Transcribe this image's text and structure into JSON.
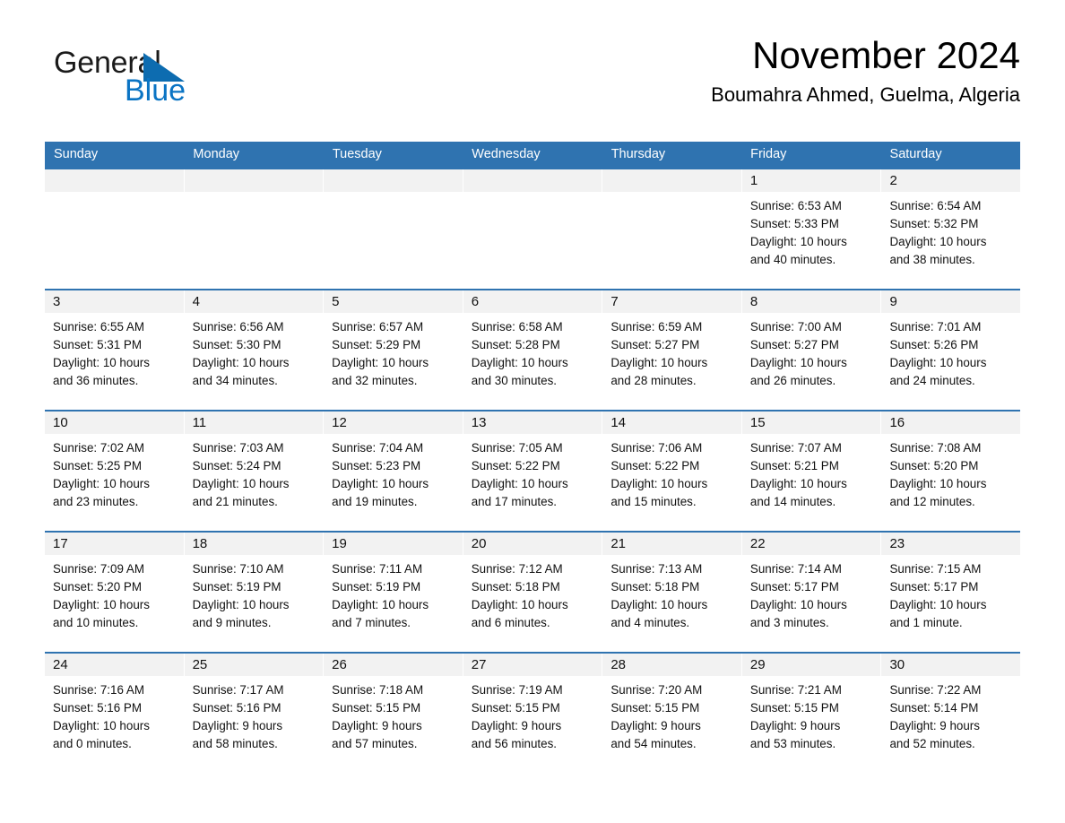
{
  "brand": {
    "word_one": "General",
    "word_two": "Blue",
    "triangle_icon": "triangle-icon",
    "blue_hex": "#0a74c4"
  },
  "header": {
    "title": "November 2024",
    "subtitle": "Boumahra Ahmed, Guelma, Algeria"
  },
  "theme": {
    "header_blue": "#2f73b0",
    "daynum_band": "#f2f2f2",
    "text": "#111111"
  },
  "weekday_headers": [
    "Sunday",
    "Monday",
    "Tuesday",
    "Wednesday",
    "Thursday",
    "Friday",
    "Saturday"
  ],
  "weeks": [
    {
      "days": [
        {
          "date": "",
          "sunrise": "",
          "sunset": "",
          "daylight_line1": "",
          "daylight_line2": "",
          "empty": true
        },
        {
          "date": "",
          "sunrise": "",
          "sunset": "",
          "daylight_line1": "",
          "daylight_line2": "",
          "empty": true
        },
        {
          "date": "",
          "sunrise": "",
          "sunset": "",
          "daylight_line1": "",
          "daylight_line2": "",
          "empty": true
        },
        {
          "date": "",
          "sunrise": "",
          "sunset": "",
          "daylight_line1": "",
          "daylight_line2": "",
          "empty": true
        },
        {
          "date": "",
          "sunrise": "",
          "sunset": "",
          "daylight_line1": "",
          "daylight_line2": "",
          "empty": true
        },
        {
          "date": "1",
          "sunrise": "Sunrise: 6:53 AM",
          "sunset": "Sunset: 5:33 PM",
          "daylight_line1": "Daylight: 10 hours",
          "daylight_line2": "and 40 minutes.",
          "empty": false
        },
        {
          "date": "2",
          "sunrise": "Sunrise: 6:54 AM",
          "sunset": "Sunset: 5:32 PM",
          "daylight_line1": "Daylight: 10 hours",
          "daylight_line2": "and 38 minutes.",
          "empty": false
        }
      ]
    },
    {
      "days": [
        {
          "date": "3",
          "sunrise": "Sunrise: 6:55 AM",
          "sunset": "Sunset: 5:31 PM",
          "daylight_line1": "Daylight: 10 hours",
          "daylight_line2": "and 36 minutes.",
          "empty": false
        },
        {
          "date": "4",
          "sunrise": "Sunrise: 6:56 AM",
          "sunset": "Sunset: 5:30 PM",
          "daylight_line1": "Daylight: 10 hours",
          "daylight_line2": "and 34 minutes.",
          "empty": false
        },
        {
          "date": "5",
          "sunrise": "Sunrise: 6:57 AM",
          "sunset": "Sunset: 5:29 PM",
          "daylight_line1": "Daylight: 10 hours",
          "daylight_line2": "and 32 minutes.",
          "empty": false
        },
        {
          "date": "6",
          "sunrise": "Sunrise: 6:58 AM",
          "sunset": "Sunset: 5:28 PM",
          "daylight_line1": "Daylight: 10 hours",
          "daylight_line2": "and 30 minutes.",
          "empty": false
        },
        {
          "date": "7",
          "sunrise": "Sunrise: 6:59 AM",
          "sunset": "Sunset: 5:27 PM",
          "daylight_line1": "Daylight: 10 hours",
          "daylight_line2": "and 28 minutes.",
          "empty": false
        },
        {
          "date": "8",
          "sunrise": "Sunrise: 7:00 AM",
          "sunset": "Sunset: 5:27 PM",
          "daylight_line1": "Daylight: 10 hours",
          "daylight_line2": "and 26 minutes.",
          "empty": false
        },
        {
          "date": "9",
          "sunrise": "Sunrise: 7:01 AM",
          "sunset": "Sunset: 5:26 PM",
          "daylight_line1": "Daylight: 10 hours",
          "daylight_line2": "and 24 minutes.",
          "empty": false
        }
      ]
    },
    {
      "days": [
        {
          "date": "10",
          "sunrise": "Sunrise: 7:02 AM",
          "sunset": "Sunset: 5:25 PM",
          "daylight_line1": "Daylight: 10 hours",
          "daylight_line2": "and 23 minutes.",
          "empty": false
        },
        {
          "date": "11",
          "sunrise": "Sunrise: 7:03 AM",
          "sunset": "Sunset: 5:24 PM",
          "daylight_line1": "Daylight: 10 hours",
          "daylight_line2": "and 21 minutes.",
          "empty": false
        },
        {
          "date": "12",
          "sunrise": "Sunrise: 7:04 AM",
          "sunset": "Sunset: 5:23 PM",
          "daylight_line1": "Daylight: 10 hours",
          "daylight_line2": "and 19 minutes.",
          "empty": false
        },
        {
          "date": "13",
          "sunrise": "Sunrise: 7:05 AM",
          "sunset": "Sunset: 5:22 PM",
          "daylight_line1": "Daylight: 10 hours",
          "daylight_line2": "and 17 minutes.",
          "empty": false
        },
        {
          "date": "14",
          "sunrise": "Sunrise: 7:06 AM",
          "sunset": "Sunset: 5:22 PM",
          "daylight_line1": "Daylight: 10 hours",
          "daylight_line2": "and 15 minutes.",
          "empty": false
        },
        {
          "date": "15",
          "sunrise": "Sunrise: 7:07 AM",
          "sunset": "Sunset: 5:21 PM",
          "daylight_line1": "Daylight: 10 hours",
          "daylight_line2": "and 14 minutes.",
          "empty": false
        },
        {
          "date": "16",
          "sunrise": "Sunrise: 7:08 AM",
          "sunset": "Sunset: 5:20 PM",
          "daylight_line1": "Daylight: 10 hours",
          "daylight_line2": "and 12 minutes.",
          "empty": false
        }
      ]
    },
    {
      "days": [
        {
          "date": "17",
          "sunrise": "Sunrise: 7:09 AM",
          "sunset": "Sunset: 5:20 PM",
          "daylight_line1": "Daylight: 10 hours",
          "daylight_line2": "and 10 minutes.",
          "empty": false
        },
        {
          "date": "18",
          "sunrise": "Sunrise: 7:10 AM",
          "sunset": "Sunset: 5:19 PM",
          "daylight_line1": "Daylight: 10 hours",
          "daylight_line2": "and 9 minutes.",
          "empty": false
        },
        {
          "date": "19",
          "sunrise": "Sunrise: 7:11 AM",
          "sunset": "Sunset: 5:19 PM",
          "daylight_line1": "Daylight: 10 hours",
          "daylight_line2": "and 7 minutes.",
          "empty": false
        },
        {
          "date": "20",
          "sunrise": "Sunrise: 7:12 AM",
          "sunset": "Sunset: 5:18 PM",
          "daylight_line1": "Daylight: 10 hours",
          "daylight_line2": "and 6 minutes.",
          "empty": false
        },
        {
          "date": "21",
          "sunrise": "Sunrise: 7:13 AM",
          "sunset": "Sunset: 5:18 PM",
          "daylight_line1": "Daylight: 10 hours",
          "daylight_line2": "and 4 minutes.",
          "empty": false
        },
        {
          "date": "22",
          "sunrise": "Sunrise: 7:14 AM",
          "sunset": "Sunset: 5:17 PM",
          "daylight_line1": "Daylight: 10 hours",
          "daylight_line2": "and 3 minutes.",
          "empty": false
        },
        {
          "date": "23",
          "sunrise": "Sunrise: 7:15 AM",
          "sunset": "Sunset: 5:17 PM",
          "daylight_line1": "Daylight: 10 hours",
          "daylight_line2": "and 1 minute.",
          "empty": false
        }
      ]
    },
    {
      "days": [
        {
          "date": "24",
          "sunrise": "Sunrise: 7:16 AM",
          "sunset": "Sunset: 5:16 PM",
          "daylight_line1": "Daylight: 10 hours",
          "daylight_line2": "and 0 minutes.",
          "empty": false
        },
        {
          "date": "25",
          "sunrise": "Sunrise: 7:17 AM",
          "sunset": "Sunset: 5:16 PM",
          "daylight_line1": "Daylight: 9 hours",
          "daylight_line2": "and 58 minutes.",
          "empty": false
        },
        {
          "date": "26",
          "sunrise": "Sunrise: 7:18 AM",
          "sunset": "Sunset: 5:15 PM",
          "daylight_line1": "Daylight: 9 hours",
          "daylight_line2": "and 57 minutes.",
          "empty": false
        },
        {
          "date": "27",
          "sunrise": "Sunrise: 7:19 AM",
          "sunset": "Sunset: 5:15 PM",
          "daylight_line1": "Daylight: 9 hours",
          "daylight_line2": "and 56 minutes.",
          "empty": false
        },
        {
          "date": "28",
          "sunrise": "Sunrise: 7:20 AM",
          "sunset": "Sunset: 5:15 PM",
          "daylight_line1": "Daylight: 9 hours",
          "daylight_line2": "and 54 minutes.",
          "empty": false
        },
        {
          "date": "29",
          "sunrise": "Sunrise: 7:21 AM",
          "sunset": "Sunset: 5:15 PM",
          "daylight_line1": "Daylight: 9 hours",
          "daylight_line2": "and 53 minutes.",
          "empty": false
        },
        {
          "date": "30",
          "sunrise": "Sunrise: 7:22 AM",
          "sunset": "Sunset: 5:14 PM",
          "daylight_line1": "Daylight: 9 hours",
          "daylight_line2": "and 52 minutes.",
          "empty": false
        }
      ]
    }
  ]
}
